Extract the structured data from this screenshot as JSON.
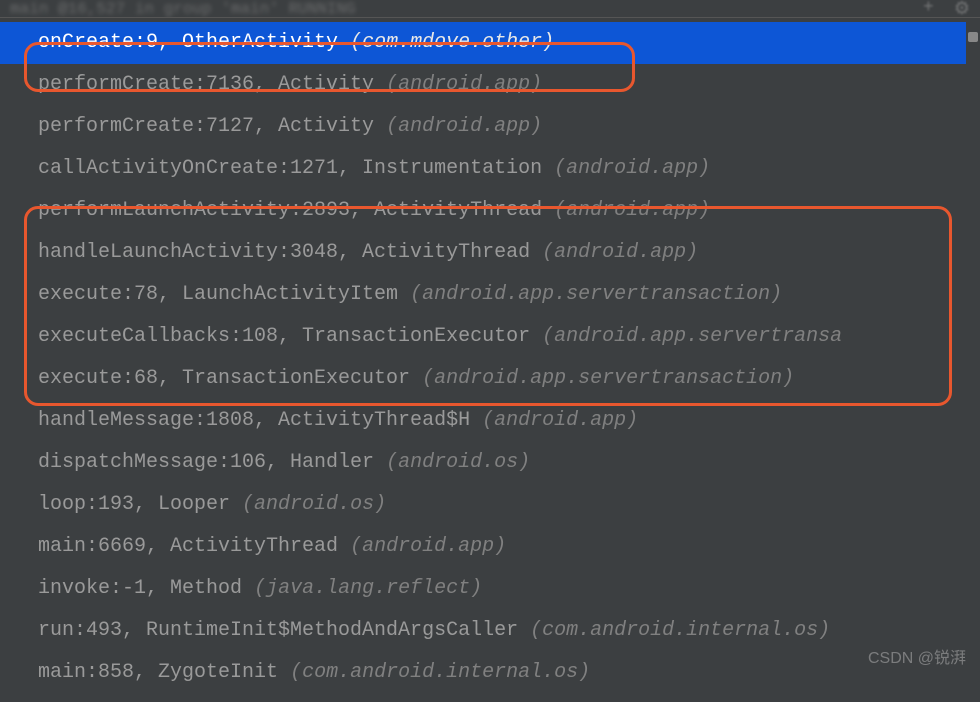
{
  "top": {
    "thread_info": "main @16,527 in group 'main' RUNNING"
  },
  "frames": [
    {
      "method": "onCreate:9, OtherActivity",
      "pkg": "(com.mdove.other)",
      "selected": true
    },
    {
      "method": "performCreate:7136, Activity",
      "pkg": "(android.app)",
      "selected": false
    },
    {
      "method": "performCreate:7127, Activity",
      "pkg": "(android.app)",
      "selected": false
    },
    {
      "method": "callActivityOnCreate:1271, Instrumentation",
      "pkg": "(android.app)",
      "selected": false
    },
    {
      "method": "performLaunchActivity:2893, ActivityThread",
      "pkg": "(android.app)",
      "selected": false
    },
    {
      "method": "handleLaunchActivity:3048, ActivityThread",
      "pkg": "(android.app)",
      "selected": false
    },
    {
      "method": "execute:78, LaunchActivityItem",
      "pkg": "(android.app.servertransaction)",
      "selected": false
    },
    {
      "method": "executeCallbacks:108, TransactionExecutor",
      "pkg": "(android.app.servertransa",
      "selected": false
    },
    {
      "method": "execute:68, TransactionExecutor",
      "pkg": "(android.app.servertransaction)",
      "selected": false
    },
    {
      "method": "handleMessage:1808, ActivityThread$H",
      "pkg": "(android.app)",
      "selected": false
    },
    {
      "method": "dispatchMessage:106, Handler",
      "pkg": "(android.os)",
      "selected": false
    },
    {
      "method": "loop:193, Looper",
      "pkg": "(android.os)",
      "selected": false
    },
    {
      "method": "main:6669, ActivityThread",
      "pkg": "(android.app)",
      "selected": false
    },
    {
      "method": "invoke:-1, Method",
      "pkg": "(java.lang.reflect)",
      "selected": false
    },
    {
      "method": "run:493, RuntimeInit$MethodAndArgsCaller",
      "pkg": "(com.android.internal.os)",
      "selected": false
    },
    {
      "method": "main:858, ZygoteInit",
      "pkg": "(com.android.internal.os)",
      "selected": false
    }
  ],
  "watermark": "CSDN @锐湃"
}
